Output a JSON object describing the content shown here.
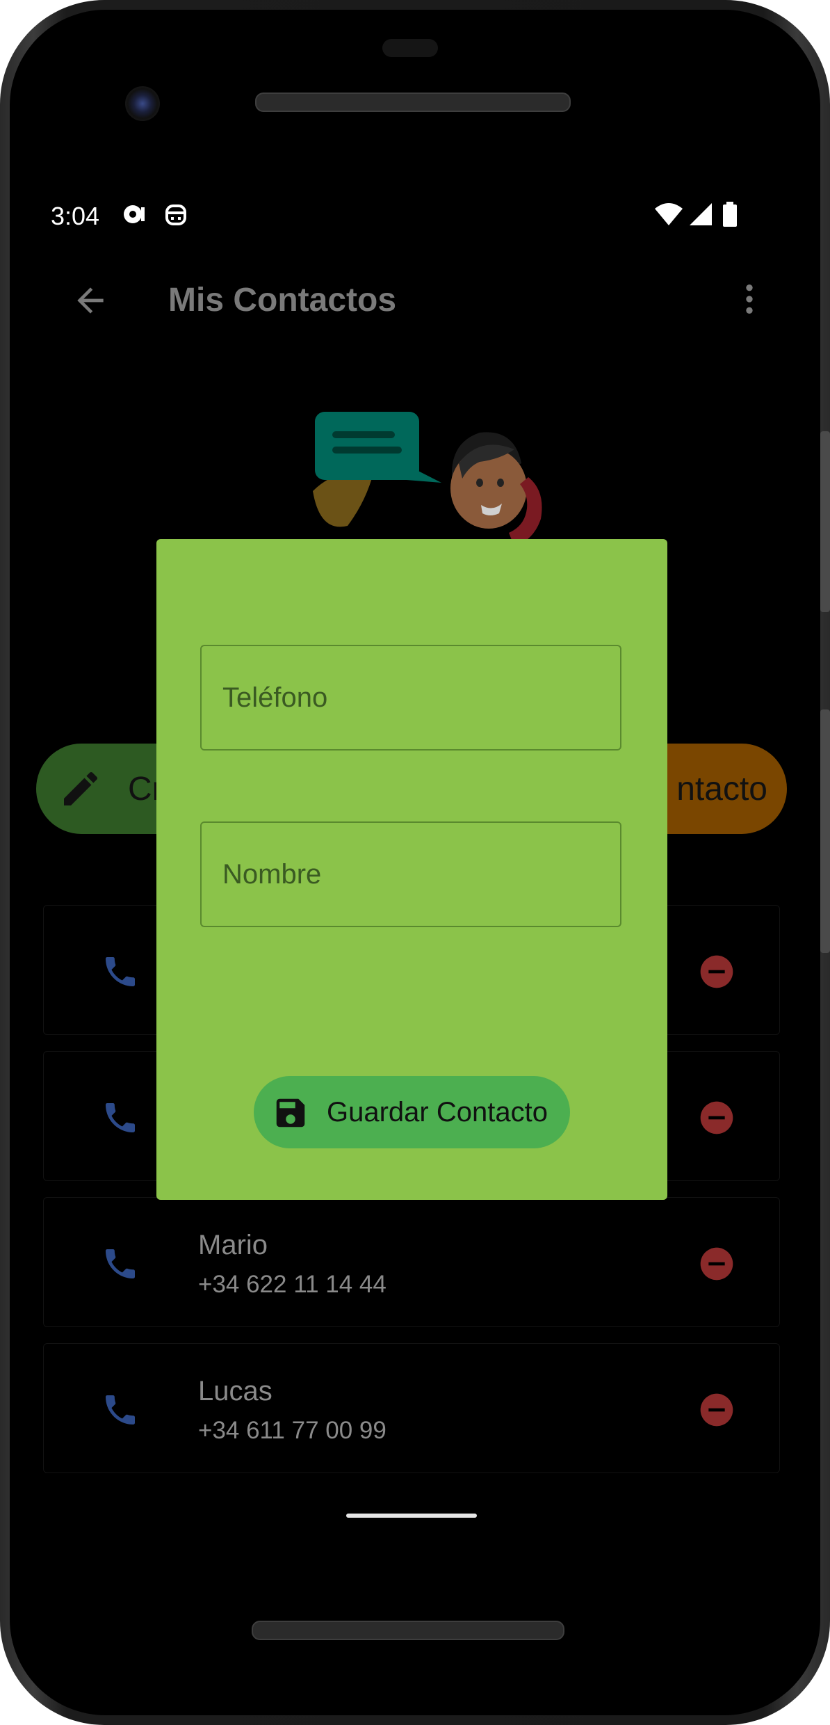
{
  "status_bar": {
    "time": "3:04"
  },
  "app_bar": {
    "title": "Mis Contactos",
    "back_icon": "arrow-back-icon",
    "menu_icon": "more-vert-icon"
  },
  "action_buttons": {
    "create_label": "Cr",
    "right_label": "ntacto"
  },
  "contacts": [
    {
      "name": "",
      "phone": ""
    },
    {
      "name": "",
      "phone": ""
    },
    {
      "name": "Mario",
      "phone": "+34 622 11 14 44"
    },
    {
      "name": "Lucas",
      "phone": "+34 611 77 00 99"
    }
  ],
  "dialog": {
    "phone_placeholder": "Teléfono",
    "name_placeholder": "Nombre",
    "save_label": "Guardar Contacto"
  },
  "colors": {
    "dialog_bg": "#8bc34a",
    "save_button": "#4caf50",
    "create_button": "#2d5a22",
    "orange_button": "#7a4600",
    "call_icon": "#2c4a8a",
    "delete_icon": "#8a2a2a"
  }
}
